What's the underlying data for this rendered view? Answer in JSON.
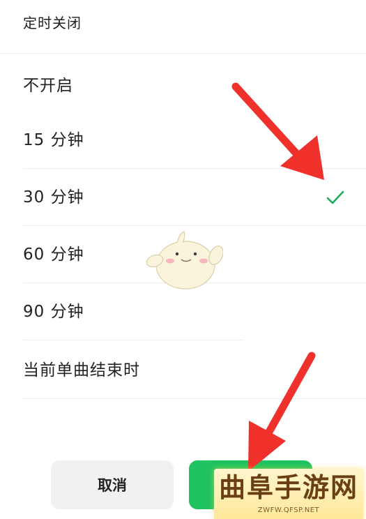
{
  "dialog": {
    "title": "定时关闭",
    "options": [
      {
        "label": "不开启",
        "selected": false
      },
      {
        "label": "15 分钟",
        "selected": false
      },
      {
        "label": "30 分钟",
        "selected": true
      },
      {
        "label": "60 分钟",
        "selected": false
      },
      {
        "label": "90 分钟",
        "selected": false
      },
      {
        "label": "当前单曲结束时",
        "selected": false
      }
    ],
    "cancel_label": "取消",
    "confirm_label": "",
    "check_icon": "checkmark-icon"
  },
  "watermark": {
    "title": "曲阜手游网",
    "url": "ZWFW.QFSP.NET"
  },
  "colors": {
    "accent": "#1fc35f",
    "check": "#1aad5a",
    "annotation_arrow": "#f0302a",
    "cancel_bg": "#f1f1f1"
  }
}
